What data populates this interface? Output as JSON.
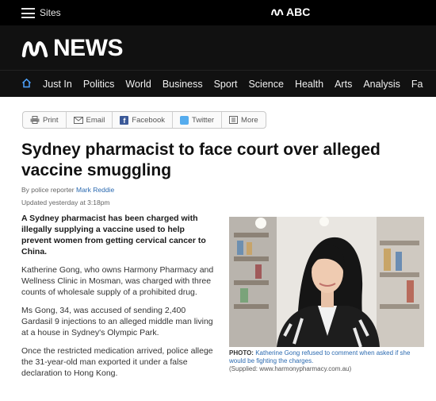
{
  "topbar": {
    "sites_label": "Sites",
    "brand": "ABC"
  },
  "masthead": {
    "logo_word": "NEWS"
  },
  "nav": {
    "items": [
      "Just In",
      "Politics",
      "World",
      "Business",
      "Sport",
      "Science",
      "Health",
      "Arts",
      "Analysis",
      "Fa"
    ]
  },
  "share": {
    "print": "Print",
    "email": "Email",
    "facebook": "Facebook",
    "twitter": "Twitter",
    "more": "More"
  },
  "article": {
    "headline": "Sydney pharmacist to face court over alleged vaccine smuggling",
    "byline_prefix": "By police reporter",
    "author": "Mark Reddie",
    "updated": "Updated yesterday at 3:18pm",
    "paragraphs": [
      "A Sydney pharmacist has been charged with illegally supplying a vaccine used to help prevent women from getting cervical cancer to China.",
      "Katherine Gong, who owns Harmony Pharmacy and Wellness Clinic in Mosman, was charged with three counts of wholesale supply of a prohibited drug.",
      "Ms Gong, 34, was accused of sending 2,400 Gardasil 9 injections to an alleged middle man living at a house in Sydney's Olympic Park.",
      "Once the restricted medication arrived, police allege the 31-year-old man exported it under a false declaration to Hong Kong."
    ]
  },
  "photo": {
    "caption_label": "PHOTO:",
    "caption_text": "Katherine Gong refused to comment when asked if she would be fighting the charges.",
    "credit": "(Supplied: www.harmonypharmacy.com.au)"
  }
}
